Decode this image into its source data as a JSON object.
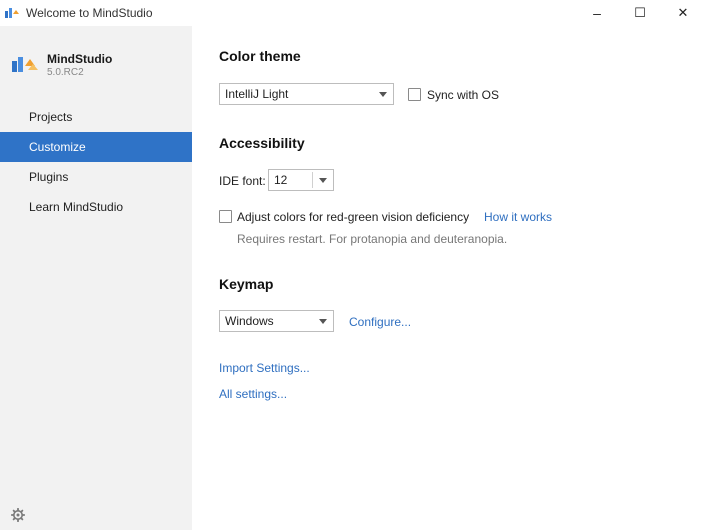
{
  "window": {
    "title": "Welcome to MindStudio",
    "minimize_glyph": "–",
    "maximize_glyph": "☐",
    "close_glyph": "✕"
  },
  "sidebar": {
    "app_name": "MindStudio",
    "version": "5.0.RC2",
    "items": [
      {
        "label": "Projects",
        "selected": false
      },
      {
        "label": "Customize",
        "selected": true
      },
      {
        "label": "Plugins",
        "selected": false
      },
      {
        "label": "Learn MindStudio",
        "selected": false
      }
    ],
    "settings_icon": "gear-icon"
  },
  "color_theme": {
    "heading": "Color theme",
    "theme_value": "IntelliJ Light",
    "sync_label": "Sync with OS",
    "sync_checked": false
  },
  "accessibility": {
    "heading": "Accessibility",
    "ide_font_label": "IDE font:",
    "ide_font_value": "12",
    "vision_label": "Adjust colors for red-green vision deficiency",
    "vision_checked": false,
    "how_it_works": "How it works",
    "restart_note": "Requires restart. For protanopia and deuteranopia."
  },
  "keymap": {
    "heading": "Keymap",
    "keymap_value": "Windows",
    "configure": "Configure..."
  },
  "links": {
    "import_settings": "Import Settings...",
    "all_settings": "All settings..."
  },
  "colors": {
    "accent": "#2f73c7",
    "link": "#2f6fc0",
    "sidebar_bg": "#f2f2f2"
  }
}
